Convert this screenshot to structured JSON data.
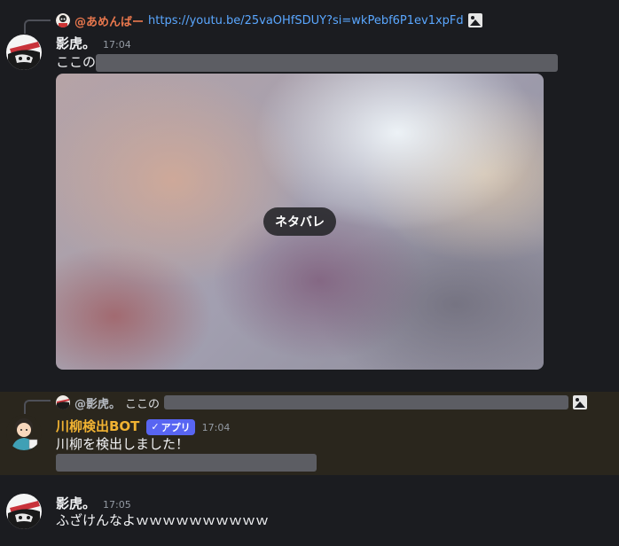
{
  "messages": [
    {
      "reply": {
        "name": "@あめんばー",
        "text": "https://youtu.be/25vaOHfSDUY?si=wkPebf6P1ev1xpFd",
        "attachment_icon": "image-icon"
      },
      "author": "影虎。",
      "time": "17:04",
      "prefix": "ここの",
      "spoiler_image_label": "ネタバレ"
    },
    {
      "reply": {
        "name": "@影虎。",
        "text": "ここの",
        "attachment_icon": "image-icon"
      },
      "author": "川柳検出BOT",
      "badge": "アプリ",
      "time": "17:04",
      "text": "川柳を検出しました！"
    },
    {
      "author": "影虎。",
      "time": "17:05",
      "text": "ふざけんなよｗｗｗｗｗｗｗｗｗｗ"
    }
  ],
  "colors": {
    "background": "#1b1c20",
    "highlight": "#2a261d",
    "link": "#5aa7ff",
    "reply_name_orange": "#e8774d",
    "bot_name": "#f0b232",
    "app_badge": "#5865f2",
    "spoiler_bar": "#5c5d63"
  }
}
